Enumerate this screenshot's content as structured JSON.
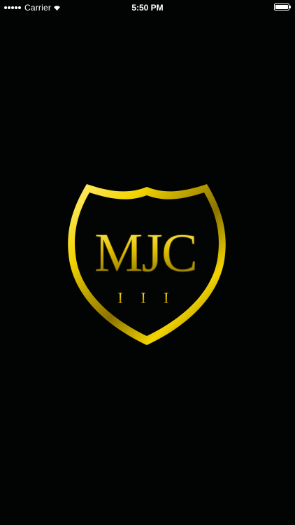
{
  "status_bar": {
    "carrier": "Carrier",
    "time": "5:50 PM",
    "battery_level": 1.0,
    "icons": [
      "signal-dots-icon",
      "wifi-icon",
      "battery-icon"
    ]
  },
  "logo": {
    "letters": "MJC",
    "numeral": "I I I",
    "colors": {
      "gold": "#f2d400",
      "gold_dark": "#7a6500",
      "gold_light": "#fff07a",
      "background": "#020403"
    }
  }
}
